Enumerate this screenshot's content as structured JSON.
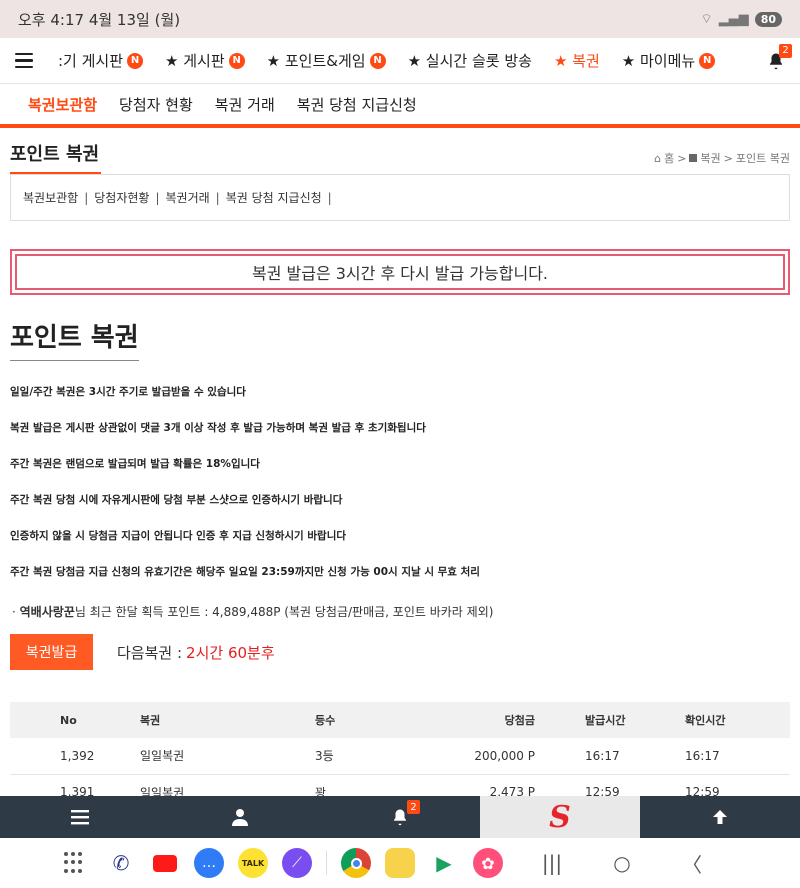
{
  "status_bar": {
    "time": "오후 4:17  4월 13일 (월)",
    "battery": "80"
  },
  "topnav": {
    "items": [
      {
        "label": ":기 게시판",
        "badge": "N"
      },
      {
        "label": "★ 게시판",
        "badge": "N"
      },
      {
        "label": "★ 포인트&게임",
        "badge": "N"
      },
      {
        "label": "★ 실시간 슬롯 방송",
        "badge": ""
      },
      {
        "label": "★ 복권",
        "badge": ""
      },
      {
        "label": "★ 마이메뉴",
        "badge": "N"
      }
    ],
    "bell_count": "2"
  },
  "subnav": {
    "items": [
      "복권보관함",
      "당첨자 현황",
      "복권 거래",
      "복권 당첨 지급신청"
    ]
  },
  "section": {
    "title": "포인트 복권",
    "breadcrumb": [
      "홈",
      "복권",
      "포인트 복권"
    ]
  },
  "submenu": {
    "items": [
      "복권보관함",
      "당첨자현황",
      "복권거래",
      "복권 당첨 지급신청"
    ]
  },
  "notice": "복권 발급은 3시간 후 다시 발급 가능합니다.",
  "main_title": "포인트 복권",
  "rules": [
    "일일/주간 복권은 3시간 주기로 발급받을 수 있습니다",
    "복권 발급은 게시판 상관없이 댓글 3개 이상 작성 후 발급 가능하며 복권 발급 후 초기화됩니다",
    "주간 복권은 랜덤으로 발급되며 발급 확률은 18%입니다",
    "주간 복권 당첨 시에 자유게시판에 당첨 부분 스샷으로 인증하시기 바랍니다",
    "인증하지 않을 시 당첨금 지급이 안됩니다 인증 후 지급 신청하시기 바랍니다",
    "주간 복권 당첨금 지급 신청의 유효기간은 해당주 일요일 23:59까지만 신청 가능 00시 지날 시 무효 처리"
  ],
  "info": {
    "user": "역배사랑꾼",
    "text": "님 최근 한달 획득 포인트 : 4,889,488P (복권 당첨금/판매금, 포인트 바카라 제외)"
  },
  "issue": {
    "button": "복권발급",
    "next_label": "다음복권 :",
    "next_value": "2시간 60분후"
  },
  "table": {
    "headers": [
      "No",
      "복권",
      "등수",
      "당첨금",
      "발급시간",
      "확인시간"
    ],
    "rows": [
      [
        "1,392",
        "일일복권",
        "3등",
        "200,000 P",
        "16:17",
        "16:17"
      ],
      [
        "1,391",
        "일일복권",
        "꽝",
        "2,473 P",
        "12:59",
        "12:59"
      ]
    ]
  },
  "bottom_bar": {
    "bell_count": "2",
    "logo": "S"
  }
}
